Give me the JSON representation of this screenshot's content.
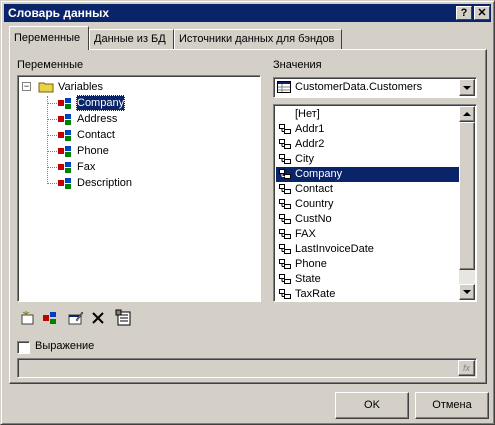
{
  "window": {
    "title": "Словарь данных",
    "help_btn": "?",
    "close_btn": "✕"
  },
  "tabs": [
    {
      "label": "Переменные",
      "active": true
    },
    {
      "label": "Данные из БД",
      "active": false
    },
    {
      "label": "Источники данных для бэндов",
      "active": false
    }
  ],
  "variables": {
    "heading": "Переменные",
    "root": "Variables",
    "items": [
      "Company",
      "Address",
      "Contact",
      "Phone",
      "Fax",
      "Description"
    ],
    "selected": "Company"
  },
  "values": {
    "heading": "Значения",
    "source": "CustomerData.Customers",
    "items": [
      "[Нет]",
      "Addr1",
      "Addr2",
      "City",
      "Company",
      "Contact",
      "Country",
      "CustNo",
      "FAX",
      "LastInvoiceDate",
      "Phone",
      "State",
      "TaxRate"
    ],
    "selected": "Company"
  },
  "toolbar": [
    "new-variable-icon",
    "add-category-icon",
    "edit-icon",
    "delete-icon",
    "properties-icon"
  ],
  "expression": {
    "label": "Выражение",
    "checked": false,
    "value": "",
    "fx_label": "fx"
  },
  "buttons": {
    "ok": "OK",
    "cancel": "Отмена"
  },
  "colors": {
    "titlebar": "#0a246a",
    "face": "#d4d0c8",
    "selection": "#0a246a",
    "folder": "#e8d44a"
  }
}
